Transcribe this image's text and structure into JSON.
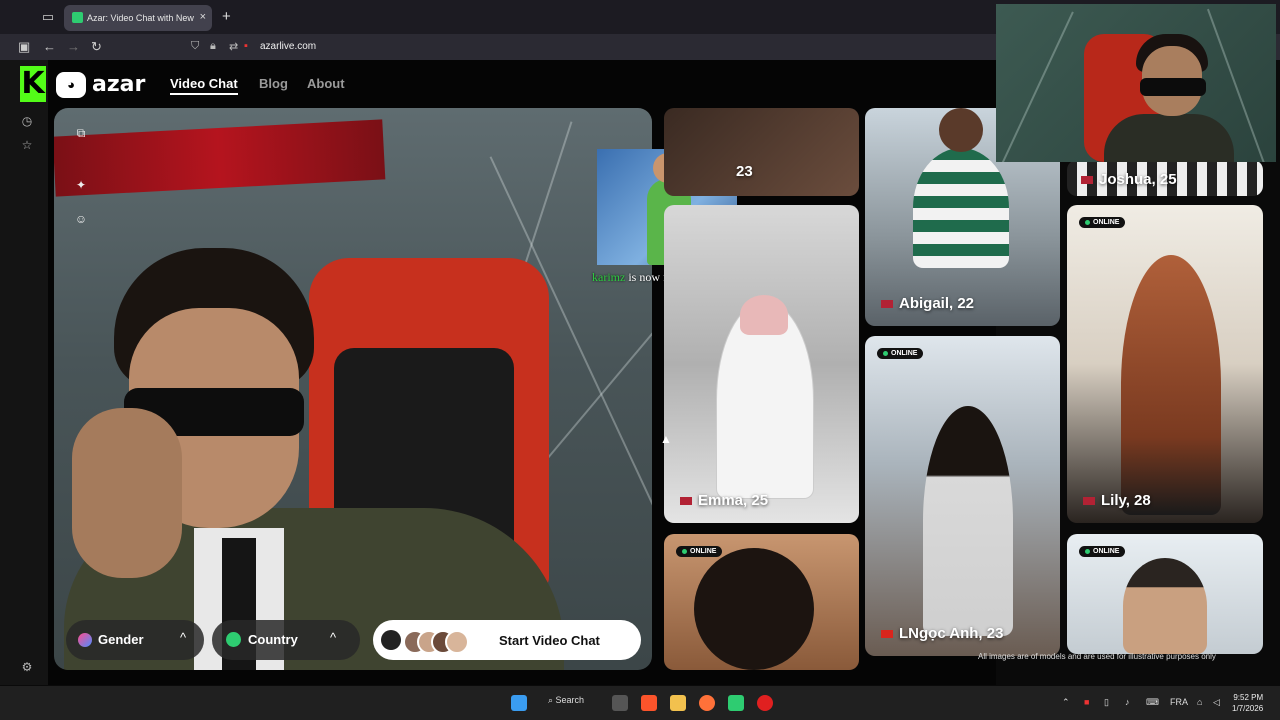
{
  "browser": {
    "tab_title": "Azar: Video Chat with New Peo",
    "tab_close": "×",
    "new_tab": "+",
    "url": "azarlive.com"
  },
  "site": {
    "logo_text": "azar",
    "nav": [
      "Video Chat",
      "Blog",
      "About"
    ],
    "active_nav": "Video Chat"
  },
  "overlay": {
    "follower_name": "karimz",
    "follow_message": "is now following!"
  },
  "controls": {
    "gender_label": "Gender",
    "country_label": "Country",
    "start_label": "Start Video Chat",
    "chevron": "^"
  },
  "profiles": [
    {
      "name": "23",
      "online": false
    },
    {
      "name": "Abigail, 22",
      "online": false
    },
    {
      "name": "Joshua, 25",
      "online": false
    },
    {
      "name": "Emma, 25",
      "online": false
    },
    {
      "name": "Lily, 28",
      "online": true
    },
    {
      "name": "LNgọc Anh, 23",
      "online": true
    },
    {
      "name": "",
      "online": true
    },
    {
      "name": "",
      "online": true
    }
  ],
  "online_label": "ONLINE",
  "disclaimer": "All images are of models and are used for illustrative purposes only",
  "taskbar": {
    "search_label": "Search",
    "language": "FRA",
    "time": "9:52 PM",
    "date": "1/7/2026"
  },
  "colors": {
    "kick_green": "#53fc18",
    "online_green": "#2ecc71",
    "follow_name": "#2ecc40"
  }
}
